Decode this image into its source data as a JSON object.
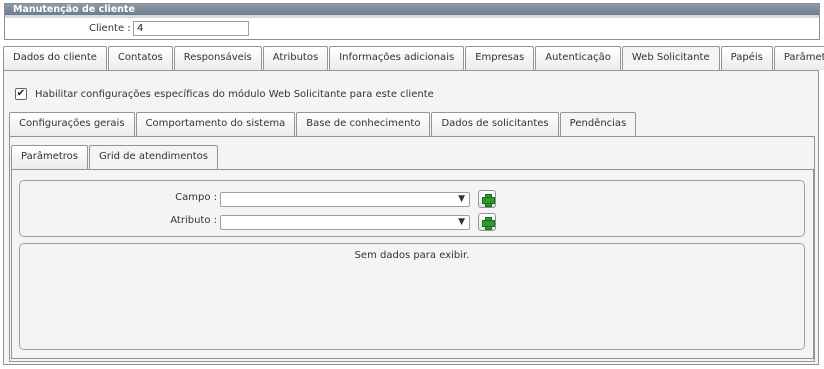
{
  "header": {
    "title": "Manutenção de cliente",
    "client_label": "Cliente :",
    "client_value": "4"
  },
  "main_tabs": [
    {
      "label": "Dados do cliente",
      "active": false
    },
    {
      "label": "Contatos",
      "active": false
    },
    {
      "label": "Responsáveis",
      "active": false
    },
    {
      "label": "Atributos",
      "active": false
    },
    {
      "label": "Informações adicionais",
      "active": false
    },
    {
      "label": "Empresas",
      "active": false
    },
    {
      "label": "Autenticação",
      "active": false
    },
    {
      "label": "Web Solicitante",
      "active": true
    },
    {
      "label": "Papéis",
      "active": false
    },
    {
      "label": "Parâmetros",
      "active": false
    }
  ],
  "web_solicitante": {
    "enable_checkbox_label": "Habilitar configurações específicas do módulo Web Solicitante para este cliente",
    "enable_checked": true
  },
  "sub_tabs": [
    {
      "label": "Configurações gerais",
      "active": false
    },
    {
      "label": "Comportamento do sistema",
      "active": false
    },
    {
      "label": "Base de conhecimento",
      "active": false
    },
    {
      "label": "Dados de solicitantes",
      "active": false
    },
    {
      "label": "Pendências",
      "active": true
    }
  ],
  "subsub_tabs": [
    {
      "label": "Parâmetros",
      "active": false
    },
    {
      "label": "Grid de atendimentos",
      "active": true
    }
  ],
  "filters": {
    "campo_label": "Campo :",
    "campo_value": "",
    "atributo_label": "Atributo :",
    "atributo_value": ""
  },
  "grid": {
    "empty_message": "Sem dados para exibir."
  },
  "icons": {
    "dropdown": "▼",
    "checkmark": "✔"
  },
  "colors": {
    "header_bar": "#7a8795",
    "add_icon": "#2f9a2c"
  }
}
